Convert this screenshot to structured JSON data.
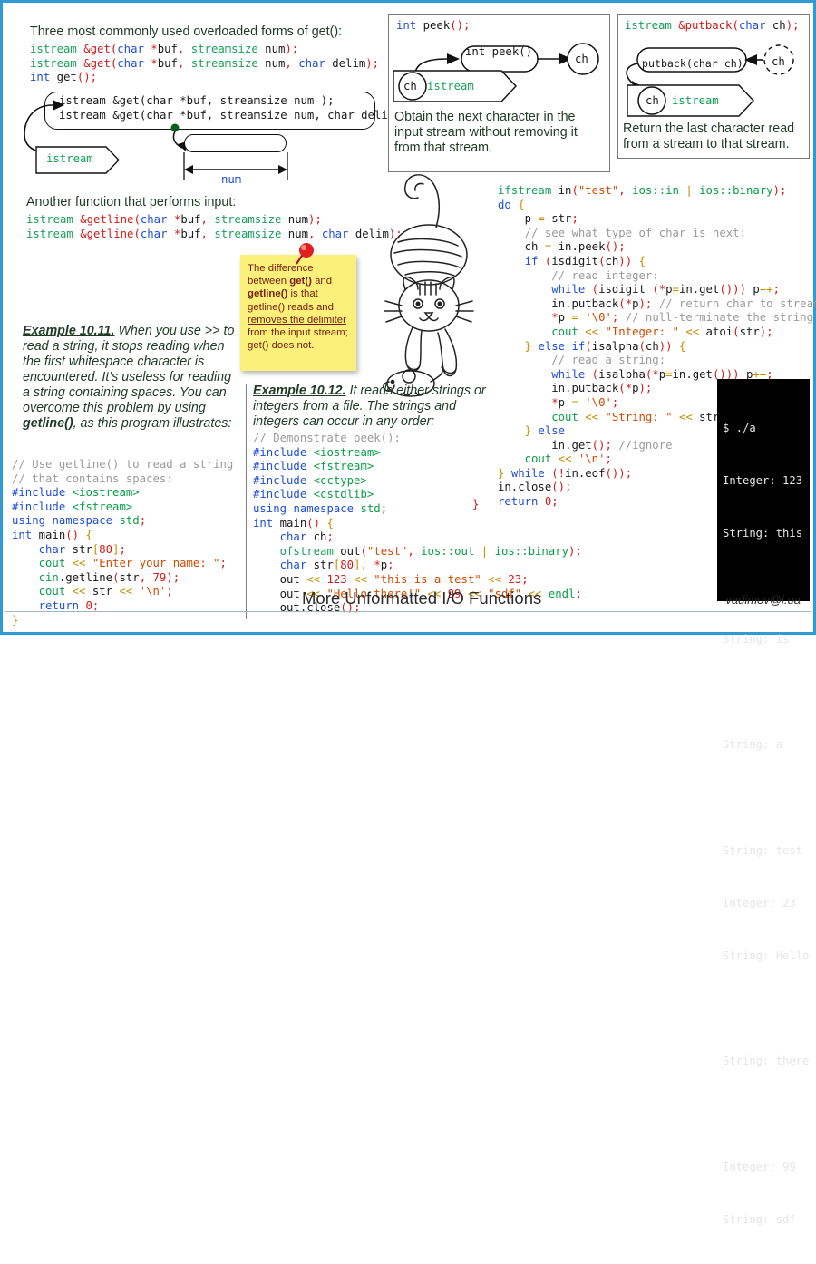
{
  "slide": {
    "title": "More Unformatted I/O Functions",
    "email": "vadimov@i.ua",
    "accent": "#2e9bd6"
  },
  "get_section": {
    "heading": "Three most commonly used overloaded forms of get():",
    "signatures": [
      "istream &get(char *buf, streamsize num);",
      "istream &get(char *buf, streamsize num, char delim);",
      "int get();"
    ],
    "diagram": {
      "line1": "istream &get(char *buf, streamsize num );",
      "line2": "istream &get(char *buf, streamsize num, char delim);",
      "stream_label": "istream",
      "buffer_label": "num"
    }
  },
  "peek_panel": {
    "signature": "int peek();",
    "node_label": "int peek()",
    "char_label": "ch",
    "stream_char_label": "ch",
    "stream_label": "istream",
    "description": "Obtain the next character in the input stream without removing it from that stream."
  },
  "putback_panel": {
    "signature": "istream &putback(char ch);",
    "node_label": "putback(char ch)",
    "char_label": "ch",
    "stream_char_label": "ch",
    "stream_label": "istream",
    "description": "Return the last character read from a stream to that stream."
  },
  "getline_section": {
    "heading": "Another function that performs input:",
    "signatures": [
      "istream &getline(char *buf, streamsize num);",
      "istream &getline(char *buf, streamsize num, char delim);"
    ]
  },
  "sticky_note": {
    "line1": "The difference",
    "line2_pre": "between ",
    "line2_bold": "get()",
    "line2_post": " and",
    "line3_bold": "getline()",
    "line3_post": " is that",
    "line4": "getline() reads and",
    "line5_underline": "removes the delimiter",
    "line6": "from the input stream;",
    "line7": " get() does not."
  },
  "example_1011": {
    "label": "Example 10.11.",
    "text_a": " When you use >> to read a string, it stops reading when the first whitespace character is encountered. It's useless for reading a string containing spaces. You can overcome this problem by using ",
    "text_bold": "getline()",
    "text_b": ", as this program illustrates:",
    "code": [
      "// Use getline() to read a string",
      "// that contains spaces:",
      "#include <iostream>",
      "#include <fstream>",
      "using namespace std;",
      "int main() {",
      "    char str[80];",
      "    cout << \"Enter your name: \";",
      "    cin.getline(str, 79);",
      "    cout << str << '\\n';",
      "    return 0;",
      "}"
    ]
  },
  "example_1012": {
    "label": "Example 10.12.",
    "text": " It reads either strings or integers from a file. The strings and integers can occur in any order:",
    "code_left": [
      "// Demonstrate peek():",
      "#include <iostream>",
      "#include <fstream>",
      "#include <cctype>",
      "#include <cstdlib>",
      "using namespace std;",
      "int main() {",
      "    char ch;",
      "    ofstream out(\"test\", ios::out | ios::binary);",
      "    char str[80], *p;",
      "    out << 123 << \"this is a test\" << 23;",
      "    out << \"Hello there!\" << 99 << \"sdf\" << endl;",
      "    out.close();"
    ],
    "closing_brace": "}",
    "code_right": [
      "ifstream in(\"test\", ios::in | ios::binary);",
      "do {",
      "    p = str;",
      "    // see what type of char is next:",
      "    ch = in.peek();",
      "    if (isdigit(ch)) {",
      "        // read integer:",
      "        while (isdigit (*p=in.get())) p++;",
      "        in.putback(*p); // return char to stream",
      "        *p = '\\0'; // null-terminate the string",
      "        cout << \"Integer: \" << atoi(str);",
      "    } else if(isalpha(ch)) {",
      "        // read a string:",
      "        while (isalpha(*p=in.get())) p++;",
      "        in.putback(*p);",
      "        *p = '\\0';",
      "        cout << \"String: \" << str;",
      "    } else",
      "        in.get(); //ignore",
      "    cout << '\\n';",
      "} while (!in.eof());",
      "in.close();",
      "return 0;"
    ]
  },
  "terminal": {
    "lines": [
      "$ ./a",
      "Integer: 123",
      "String: this",
      "",
      "String: is",
      "",
      "String: a",
      "",
      "String: test",
      "Integer: 23",
      "String: Hello",
      "",
      "String: there",
      "",
      "Integer: 99",
      "String: sdf"
    ]
  }
}
